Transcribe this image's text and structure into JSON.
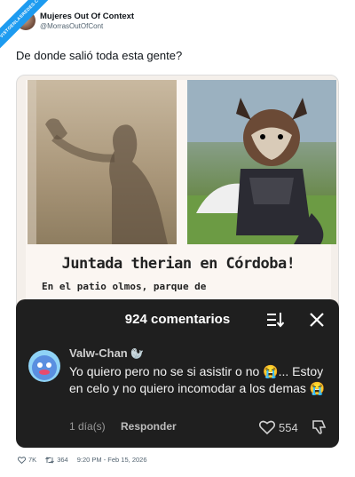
{
  "watermark": "VISTOENLASREDES.COM",
  "author": {
    "display_name": "Mujeres Out Of Context",
    "handle": "@MorrasOutOfCont"
  },
  "tweet_text": "De donde salió toda esta gente?",
  "flyer": {
    "title": "Juntada therian en Córdoba!",
    "subtitle": "En el patio olmos, parque de"
  },
  "comments_sheet": {
    "title": "924 comentarios",
    "comment": {
      "user": "Valw-Chan",
      "text": "Yo quiero pero no se si asistir o no 😭... Estoy en celo y no quiero incomodar a los demas 😭",
      "time": "1 día(s)",
      "reply_label": "Responder",
      "likes": "554"
    }
  },
  "footer": {
    "likes": "7K",
    "retweets": "364",
    "timestamp": "9:20 PM - Feb 15, 2026"
  },
  "colors": {
    "accent": "#1d9bf0",
    "sheet_bg": "#1f1f1f"
  }
}
